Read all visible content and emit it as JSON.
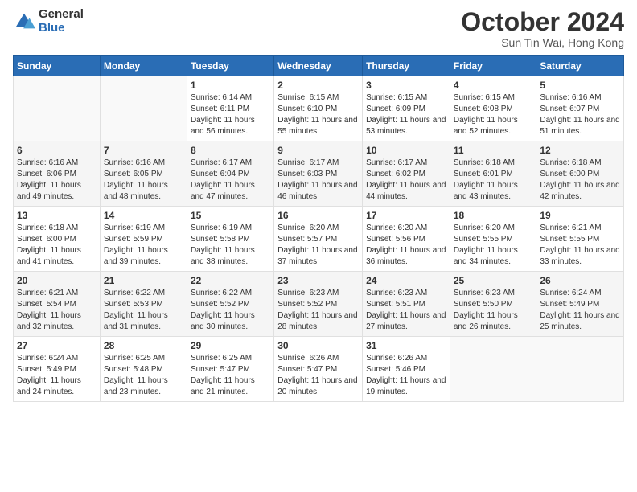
{
  "header": {
    "logo": {
      "general": "General",
      "blue": "Blue"
    },
    "title": "October 2024",
    "subtitle": "Sun Tin Wai, Hong Kong"
  },
  "weekdays": [
    "Sunday",
    "Monday",
    "Tuesday",
    "Wednesday",
    "Thursday",
    "Friday",
    "Saturday"
  ],
  "weeks": [
    [
      null,
      null,
      {
        "day": 1,
        "sunrise": "6:14 AM",
        "sunset": "6:11 PM",
        "daylight": "11 hours and 56 minutes."
      },
      {
        "day": 2,
        "sunrise": "6:15 AM",
        "sunset": "6:10 PM",
        "daylight": "11 hours and 55 minutes."
      },
      {
        "day": 3,
        "sunrise": "6:15 AM",
        "sunset": "6:09 PM",
        "daylight": "11 hours and 53 minutes."
      },
      {
        "day": 4,
        "sunrise": "6:15 AM",
        "sunset": "6:08 PM",
        "daylight": "11 hours and 52 minutes."
      },
      {
        "day": 5,
        "sunrise": "6:16 AM",
        "sunset": "6:07 PM",
        "daylight": "11 hours and 51 minutes."
      }
    ],
    [
      {
        "day": 6,
        "sunrise": "6:16 AM",
        "sunset": "6:06 PM",
        "daylight": "11 hours and 49 minutes."
      },
      {
        "day": 7,
        "sunrise": "6:16 AM",
        "sunset": "6:05 PM",
        "daylight": "11 hours and 48 minutes."
      },
      {
        "day": 8,
        "sunrise": "6:17 AM",
        "sunset": "6:04 PM",
        "daylight": "11 hours and 47 minutes."
      },
      {
        "day": 9,
        "sunrise": "6:17 AM",
        "sunset": "6:03 PM",
        "daylight": "11 hours and 46 minutes."
      },
      {
        "day": 10,
        "sunrise": "6:17 AM",
        "sunset": "6:02 PM",
        "daylight": "11 hours and 44 minutes."
      },
      {
        "day": 11,
        "sunrise": "6:18 AM",
        "sunset": "6:01 PM",
        "daylight": "11 hours and 43 minutes."
      },
      {
        "day": 12,
        "sunrise": "6:18 AM",
        "sunset": "6:00 PM",
        "daylight": "11 hours and 42 minutes."
      }
    ],
    [
      {
        "day": 13,
        "sunrise": "6:18 AM",
        "sunset": "6:00 PM",
        "daylight": "11 hours and 41 minutes."
      },
      {
        "day": 14,
        "sunrise": "6:19 AM",
        "sunset": "5:59 PM",
        "daylight": "11 hours and 39 minutes."
      },
      {
        "day": 15,
        "sunrise": "6:19 AM",
        "sunset": "5:58 PM",
        "daylight": "11 hours and 38 minutes."
      },
      {
        "day": 16,
        "sunrise": "6:20 AM",
        "sunset": "5:57 PM",
        "daylight": "11 hours and 37 minutes."
      },
      {
        "day": 17,
        "sunrise": "6:20 AM",
        "sunset": "5:56 PM",
        "daylight": "11 hours and 36 minutes."
      },
      {
        "day": 18,
        "sunrise": "6:20 AM",
        "sunset": "5:55 PM",
        "daylight": "11 hours and 34 minutes."
      },
      {
        "day": 19,
        "sunrise": "6:21 AM",
        "sunset": "5:55 PM",
        "daylight": "11 hours and 33 minutes."
      }
    ],
    [
      {
        "day": 20,
        "sunrise": "6:21 AM",
        "sunset": "5:54 PM",
        "daylight": "11 hours and 32 minutes."
      },
      {
        "day": 21,
        "sunrise": "6:22 AM",
        "sunset": "5:53 PM",
        "daylight": "11 hours and 31 minutes."
      },
      {
        "day": 22,
        "sunrise": "6:22 AM",
        "sunset": "5:52 PM",
        "daylight": "11 hours and 30 minutes."
      },
      {
        "day": 23,
        "sunrise": "6:23 AM",
        "sunset": "5:52 PM",
        "daylight": "11 hours and 28 minutes."
      },
      {
        "day": 24,
        "sunrise": "6:23 AM",
        "sunset": "5:51 PM",
        "daylight": "11 hours and 27 minutes."
      },
      {
        "day": 25,
        "sunrise": "6:23 AM",
        "sunset": "5:50 PM",
        "daylight": "11 hours and 26 minutes."
      },
      {
        "day": 26,
        "sunrise": "6:24 AM",
        "sunset": "5:49 PM",
        "daylight": "11 hours and 25 minutes."
      }
    ],
    [
      {
        "day": 27,
        "sunrise": "6:24 AM",
        "sunset": "5:49 PM",
        "daylight": "11 hours and 24 minutes."
      },
      {
        "day": 28,
        "sunrise": "6:25 AM",
        "sunset": "5:48 PM",
        "daylight": "11 hours and 23 minutes."
      },
      {
        "day": 29,
        "sunrise": "6:25 AM",
        "sunset": "5:47 PM",
        "daylight": "11 hours and 21 minutes."
      },
      {
        "day": 30,
        "sunrise": "6:26 AM",
        "sunset": "5:47 PM",
        "daylight": "11 hours and 20 minutes."
      },
      {
        "day": 31,
        "sunrise": "6:26 AM",
        "sunset": "5:46 PM",
        "daylight": "11 hours and 19 minutes."
      },
      null,
      null
    ]
  ],
  "labels": {
    "sunrise_prefix": "Sunrise: ",
    "sunset_prefix": "Sunset: ",
    "daylight_prefix": "Daylight: "
  }
}
